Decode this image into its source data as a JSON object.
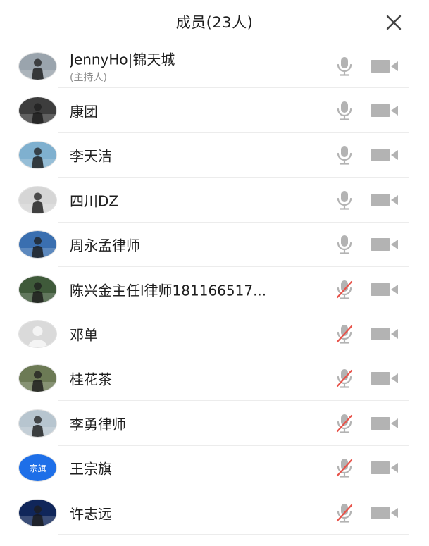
{
  "header": {
    "title": "成员(23人)"
  },
  "members": [
    {
      "name": "JennyHo|锦天城",
      "role": "(主持人)",
      "mic": "on",
      "avatar": "photo",
      "bg": "#9aa4ad"
    },
    {
      "name": "康团",
      "mic": "on",
      "avatar": "photo",
      "bg": "#3d3d3d"
    },
    {
      "name": "李天洁",
      "mic": "on",
      "avatar": "photo",
      "bg": "#7fb0cf"
    },
    {
      "name": "四川DZ",
      "mic": "on",
      "avatar": "photo",
      "bg": "#d6d6d6"
    },
    {
      "name": "周永孟律师",
      "mic": "on",
      "avatar": "photo",
      "bg": "#3a6fb0"
    },
    {
      "name": "陈兴金主任l律师181166517...",
      "mic": "muted",
      "avatar": "photo",
      "bg": "#3f5a3a"
    },
    {
      "name": "邓单",
      "mic": "muted",
      "avatar": "default",
      "bg": "#dadada"
    },
    {
      "name": "桂花茶",
      "mic": "muted",
      "avatar": "photo",
      "bg": "#6c7a55"
    },
    {
      "name": "李勇律师",
      "mic": "muted",
      "avatar": "photo",
      "bg": "#b7c5cf"
    },
    {
      "name": "王宗旗",
      "mic": "muted",
      "avatar": "text",
      "avatar_text": "宗旗",
      "bg": "#1e6fe8"
    },
    {
      "name": "许志远",
      "mic": "muted",
      "avatar": "photo",
      "bg": "#10265a"
    }
  ],
  "icons": {
    "mic": "microphone-icon",
    "mic_muted": "microphone-muted-icon",
    "camera": "video-camera-icon",
    "close": "close-icon"
  },
  "colors": {
    "icon_gray": "#b3b3b3",
    "mute_red": "#e8534a"
  }
}
